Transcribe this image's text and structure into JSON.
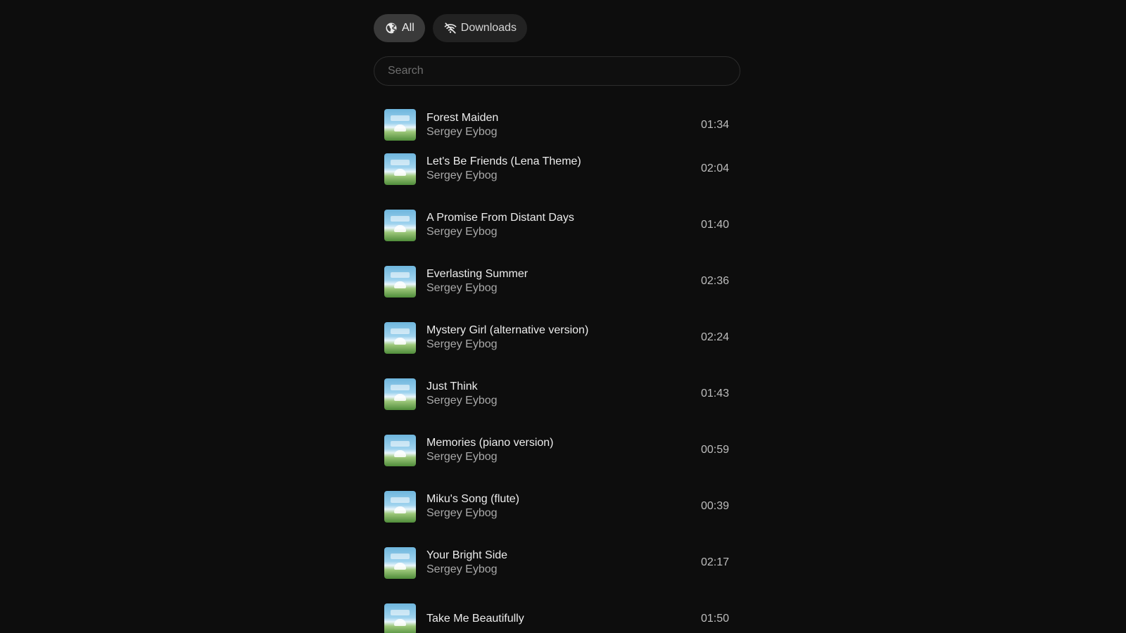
{
  "filters": {
    "all_label": "All",
    "downloads_label": "Downloads"
  },
  "search": {
    "placeholder": "Search",
    "value": ""
  },
  "tracks": [
    {
      "title": "Forest Maiden",
      "artist": "Sergey Eybog",
      "duration": "01:34"
    },
    {
      "title": "Let's Be Friends (Lena Theme)",
      "artist": "Sergey Eybog",
      "duration": "02:04"
    },
    {
      "title": "A Promise From Distant Days",
      "artist": "Sergey Eybog",
      "duration": "01:40"
    },
    {
      "title": "Everlasting Summer",
      "artist": "Sergey Eybog",
      "duration": "02:36"
    },
    {
      "title": "Mystery Girl (alternative version)",
      "artist": "Sergey Eybog",
      "duration": "02:24"
    },
    {
      "title": "Just Think",
      "artist": "Sergey Eybog",
      "duration": "01:43"
    },
    {
      "title": "Memories (piano version)",
      "artist": "Sergey Eybog",
      "duration": "00:59"
    },
    {
      "title": "Miku's Song (flute)",
      "artist": "Sergey Eybog",
      "duration": "00:39"
    },
    {
      "title": "Your Bright Side",
      "artist": "Sergey Eybog",
      "duration": "02:17"
    },
    {
      "title": "Take Me Beautifully",
      "artist": "",
      "duration": "01:50"
    }
  ],
  "colors": {
    "background": "#0d0d0d",
    "chip_active": "#3a3a3a",
    "chip": "#222222",
    "text_primary": "#ececec",
    "text_secondary": "#a9a9a9"
  }
}
